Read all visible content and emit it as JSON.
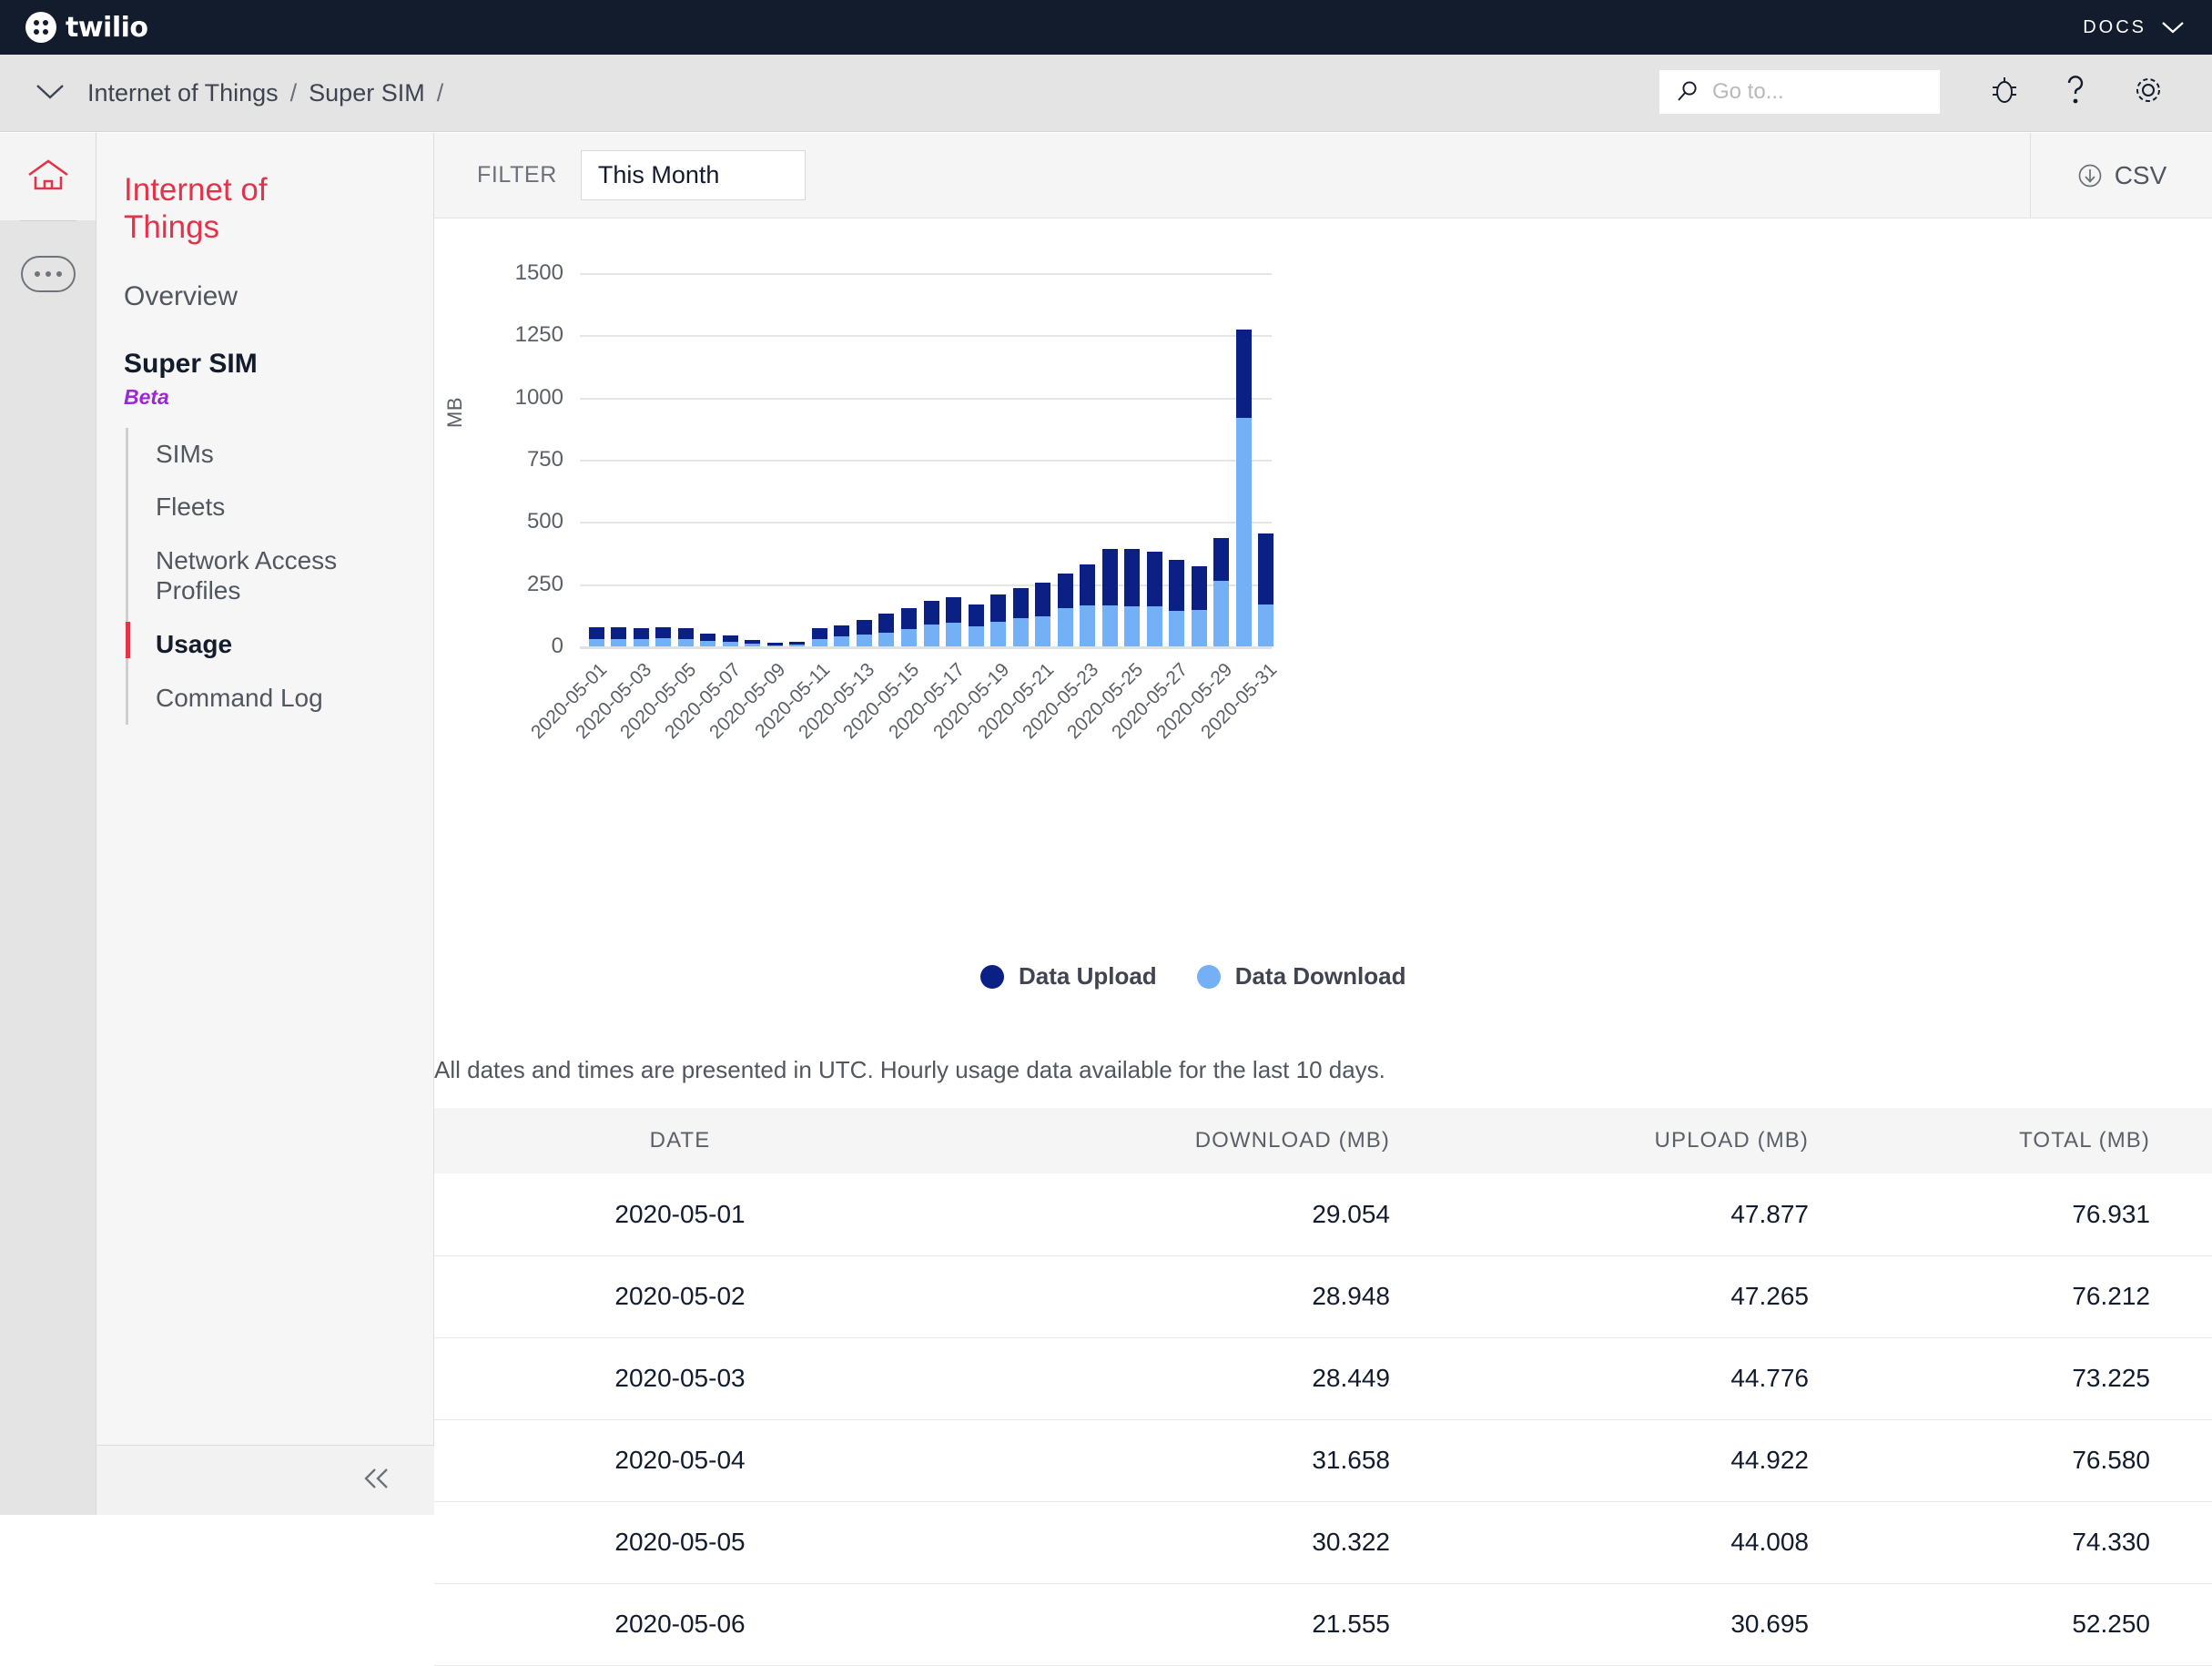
{
  "topbar": {
    "brand": "twilio",
    "docs_label": "DOCS",
    "logo_icon": "twilio-logo-icon",
    "caret_icon": "chevron-down-icon"
  },
  "breadcrumb": {
    "caret_icon": "chevron-down-icon",
    "items": [
      "Internet of Things",
      "Super SIM"
    ],
    "separator": "/",
    "trailing_separator": "/"
  },
  "search": {
    "placeholder": "Go to...",
    "value": "",
    "icon": "search-icon"
  },
  "toolbar_icons": [
    {
      "name": "bug-icon",
      "label": "Report a bug"
    },
    {
      "name": "question-mark-icon",
      "label": "Help"
    },
    {
      "name": "gear-icon",
      "label": "Settings"
    }
  ],
  "rail": {
    "home_icon": "home-icon",
    "more_icon": "ellipsis-icon"
  },
  "sidebar": {
    "title": "Internet of Things",
    "overview_label": "Overview",
    "group_label": "Super SIM",
    "group_badge": "Beta",
    "items": [
      {
        "label": "SIMs",
        "active": false
      },
      {
        "label": "Fleets",
        "active": false
      },
      {
        "label": "Network Access Profiles",
        "active": false
      },
      {
        "label": "Usage",
        "active": true
      },
      {
        "label": "Command Log",
        "active": false
      }
    ],
    "collapse_icon": "double-chevron-left-icon"
  },
  "filterbar": {
    "label": "FILTER",
    "selected": "This Month",
    "csv_label": "CSV",
    "csv_icon": "download-circle-icon"
  },
  "chart_data": {
    "type": "bar",
    "stacked": true,
    "title": "",
    "xlabel": "",
    "ylabel": "MB",
    "ylim": [
      0,
      1500
    ],
    "yticks": [
      0,
      250,
      500,
      750,
      1000,
      1250,
      1500
    ],
    "grid": true,
    "legend_position": "bottom",
    "x": [
      "2020-05-01",
      "2020-05-02",
      "2020-05-03",
      "2020-05-04",
      "2020-05-05",
      "2020-05-06",
      "2020-05-07",
      "2020-05-08",
      "2020-05-09",
      "2020-05-10",
      "2020-05-11",
      "2020-05-12",
      "2020-05-13",
      "2020-05-14",
      "2020-05-15",
      "2020-05-16",
      "2020-05-17",
      "2020-05-18",
      "2020-05-19",
      "2020-05-20",
      "2020-05-21",
      "2020-05-22",
      "2020-05-23",
      "2020-05-24",
      "2020-05-25",
      "2020-05-26",
      "2020-05-27",
      "2020-05-28",
      "2020-05-29",
      "2020-05-30",
      "2020-05-31"
    ],
    "xtick_labels": [
      "2020-05-01",
      "2020-05-03",
      "2020-05-05",
      "2020-05-07",
      "2020-05-09",
      "2020-05-11",
      "2020-05-13",
      "2020-05-15",
      "2020-05-17",
      "2020-05-19",
      "2020-05-21",
      "2020-05-23",
      "2020-05-25",
      "2020-05-27",
      "2020-05-29",
      "2020-05-31"
    ],
    "series": [
      {
        "name": "Data Download",
        "color": "#74b0f6",
        "values": [
          29.054,
          28.948,
          28.449,
          31.658,
          30.322,
          21.555,
          19.0,
          10.0,
          5.0,
          7.0,
          30.0,
          41.0,
          47.0,
          56.0,
          70.0,
          88.0,
          96.0,
          80.0,
          100.0,
          112.0,
          120.0,
          152.0,
          163.0,
          166.0,
          160.0,
          160.0,
          143.0,
          145.0,
          262.0,
          920.0,
          168.0
        ]
      },
      {
        "name": "Data Upload",
        "color": "#0a2084",
        "values": [
          47.877,
          47.265,
          44.776,
          44.922,
          44.008,
          30.695,
          26.0,
          14.0,
          8.0,
          10.0,
          45.0,
          42.0,
          58.0,
          75.0,
          85.0,
          96.0,
          100.0,
          87.0,
          110.0,
          124.0,
          135.0,
          142.0,
          165.0,
          224.0,
          232.0,
          222.0,
          203.0,
          176.0,
          172.0,
          354.0,
          284.0
        ]
      }
    ],
    "legend": [
      {
        "label": "Data Upload",
        "color": "#0a2084"
      },
      {
        "label": "Data Download",
        "color": "#74b0f6"
      }
    ]
  },
  "table": {
    "note": "All dates and times are presented in UTC. Hourly usage data available for the last 10 days.",
    "columns": [
      "DATE",
      "DOWNLOAD (MB)",
      "UPLOAD (MB)",
      "TOTAL (MB)"
    ],
    "rows": [
      {
        "date": "2020-05-01",
        "download": "29.054",
        "upload": "47.877",
        "total": "76.931"
      },
      {
        "date": "2020-05-02",
        "download": "28.948",
        "upload": "47.265",
        "total": "76.212"
      },
      {
        "date": "2020-05-03",
        "download": "28.449",
        "upload": "44.776",
        "total": "73.225"
      },
      {
        "date": "2020-05-04",
        "download": "31.658",
        "upload": "44.922",
        "total": "76.580"
      },
      {
        "date": "2020-05-05",
        "download": "30.322",
        "upload": "44.008",
        "total": "74.330"
      },
      {
        "date": "2020-05-06",
        "download": "21.555",
        "upload": "30.695",
        "total": "52.250"
      }
    ]
  },
  "colors": {
    "brand_red": "#e2334b",
    "topbar_bg": "#121c2d",
    "upload": "#0a2084",
    "download": "#74b0f6",
    "beta_purple": "#9c27d4"
  }
}
